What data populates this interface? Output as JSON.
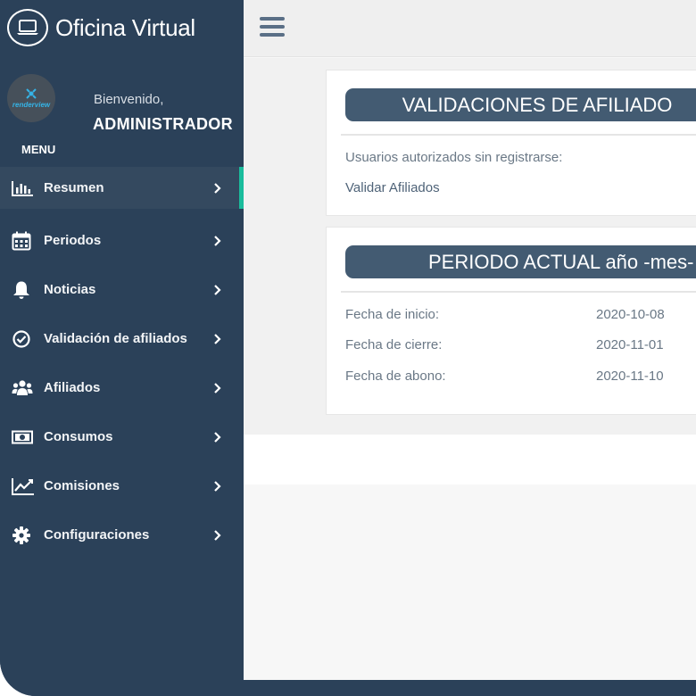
{
  "app": {
    "title": "Oficina Virtual",
    "logo_text": "renderview"
  },
  "user": {
    "greeting": "Bienvenido,",
    "name": "ADMINISTRADOR"
  },
  "menu": {
    "heading": "MENU",
    "items": [
      {
        "label": "Resumen",
        "icon": "chart-bar-icon",
        "active": true
      },
      {
        "label": "Periodos",
        "icon": "calendar-icon"
      },
      {
        "label": "Noticias",
        "icon": "bell-icon"
      },
      {
        "label": "Validación de afiliados",
        "icon": "check-circle-icon"
      },
      {
        "label": "Afiliados",
        "icon": "users-icon"
      },
      {
        "label": "Consumos",
        "icon": "money-icon"
      },
      {
        "label": "Comisiones",
        "icon": "line-chart-icon"
      },
      {
        "label": "Configuraciones",
        "icon": "gear-icon"
      }
    ]
  },
  "validations_card": {
    "title": "VALIDACIONES DE AFILIADO",
    "pending_label": "Usuarios autorizados sin registrarse:",
    "validate_link": "Validar Afiliados"
  },
  "period_card": {
    "title": "PERIODO ACTUAL año -mes- d",
    "rows": [
      {
        "label": "Fecha de inicio:",
        "value": "2020-10-08"
      },
      {
        "label": "Fecha de cierre:",
        "value": "2020-11-01"
      },
      {
        "label": "Fecha de abono:",
        "value": "2020-11-10"
      }
    ]
  },
  "colors": {
    "sidebar_bg": "#2b4159",
    "active_indicator": "#1abc9c",
    "card_header_bg": "#435b72"
  }
}
